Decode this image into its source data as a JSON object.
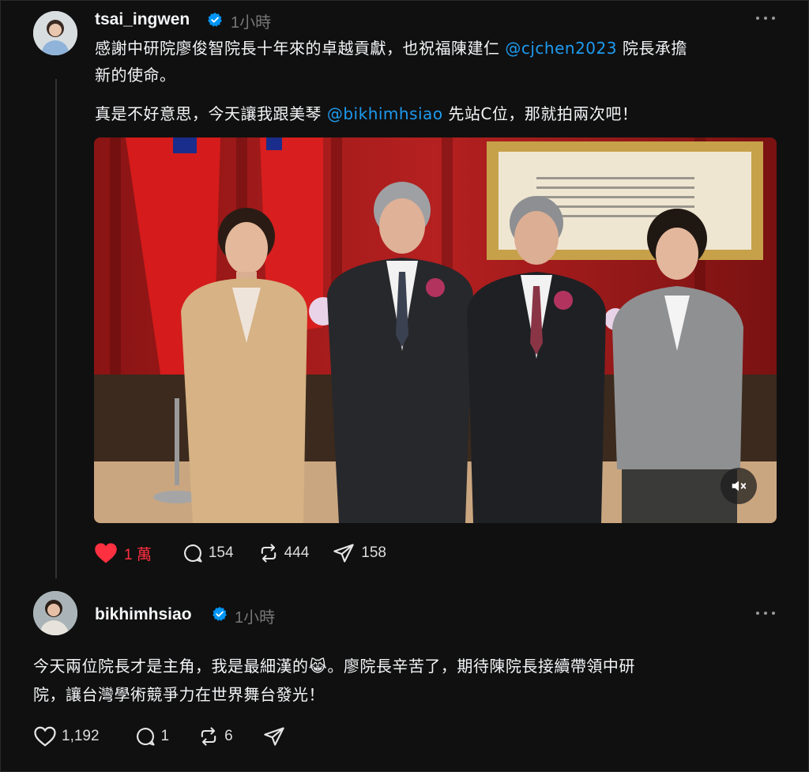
{
  "post1": {
    "username": "tsai_ingwen",
    "time": "1小時",
    "line1_a": "感謝中研院廖俊智院長十年來的卓越貢獻，也祝福陳建仁 ",
    "line1_mention": "@cjchen2023",
    "line1_b": " 院長承擔",
    "line2": "新的使命。",
    "line3_a": "真是不好意思，今天讓我跟美琴 ",
    "line3_mention": "@bikhimhsiao",
    "line3_b": " 先站C位，那就拍兩次吧！",
    "likes": "1 萬",
    "comments": "154",
    "reposts": "444",
    "shares": "158"
  },
  "post2": {
    "username": "bikhimhsiao",
    "time": "1小時",
    "line1_a": "今天兩位院長才是主角，我是最細漢的",
    "line1_emoji": "😹",
    "line1_b": "。廖院長辛苦了，期待陳院長接續帶領中研",
    "line2": "院，讓台灣學術競爭力在世界舞台發光！",
    "likes": "1,192",
    "comments": "1",
    "reposts": "6"
  },
  "colors": {
    "background": "#101010",
    "like_active": "#ff3040",
    "mention": "#1d9bf0",
    "verified": "#0095f6"
  }
}
